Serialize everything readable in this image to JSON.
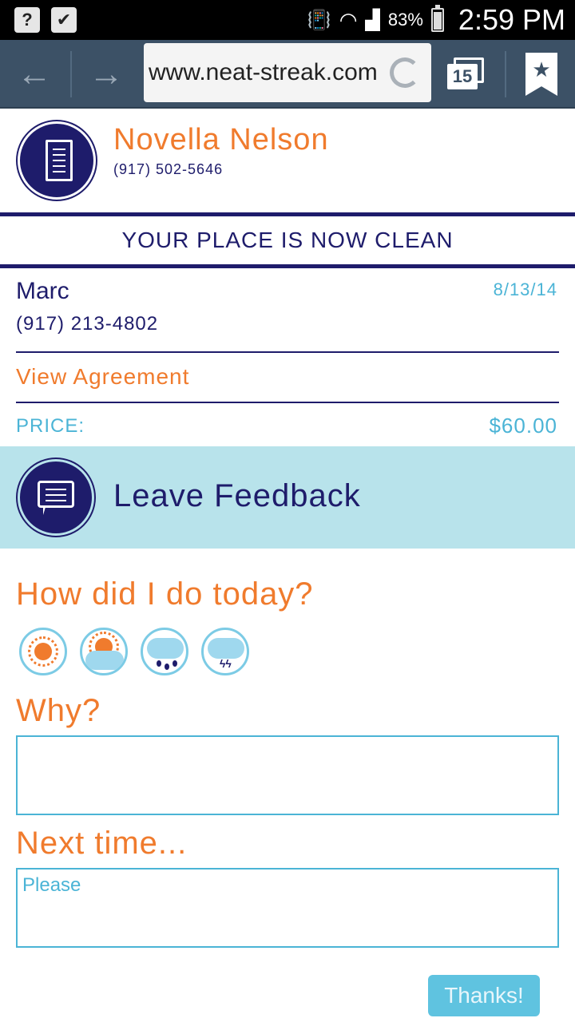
{
  "status_bar": {
    "battery": "83%",
    "time": "2:59 PM",
    "left_icons": [
      "help-icon",
      "bag-check-icon"
    ],
    "right_icons": [
      "vibrate-icon",
      "wifi-icon",
      "signal-icon",
      "battery-icon"
    ]
  },
  "browser": {
    "url": "www.neat-streak.com",
    "tab_count": "15"
  },
  "vendor": {
    "name": "Novella Nelson",
    "phone": "(917) 502-5646"
  },
  "banner": {
    "text": "YOUR PLACE IS NOW CLEAN"
  },
  "customer": {
    "name": "Marc",
    "phone": "(917) 213-4802",
    "date": "8/13/14"
  },
  "agreement": {
    "link_label": "View Agreement"
  },
  "price": {
    "label": "PRICE:",
    "value": "$60.00"
  },
  "feedback": {
    "title": "Leave Feedback",
    "rating_question": "How did I do today?",
    "rating_options": [
      "sunny-icon",
      "partly-cloudy-icon",
      "rain-icon",
      "thunderstorm-icon"
    ],
    "why_label": "Why?",
    "why_value": "",
    "next_label": "Next time...",
    "next_placeholder": "Please",
    "submit_label": "Thanks!"
  },
  "colors": {
    "navy": "#1e1c6b",
    "orange": "#f07b2d",
    "light_blue": "#4bb4d6",
    "band": "#b8e3eb",
    "browser_bar": "#3c5166"
  }
}
